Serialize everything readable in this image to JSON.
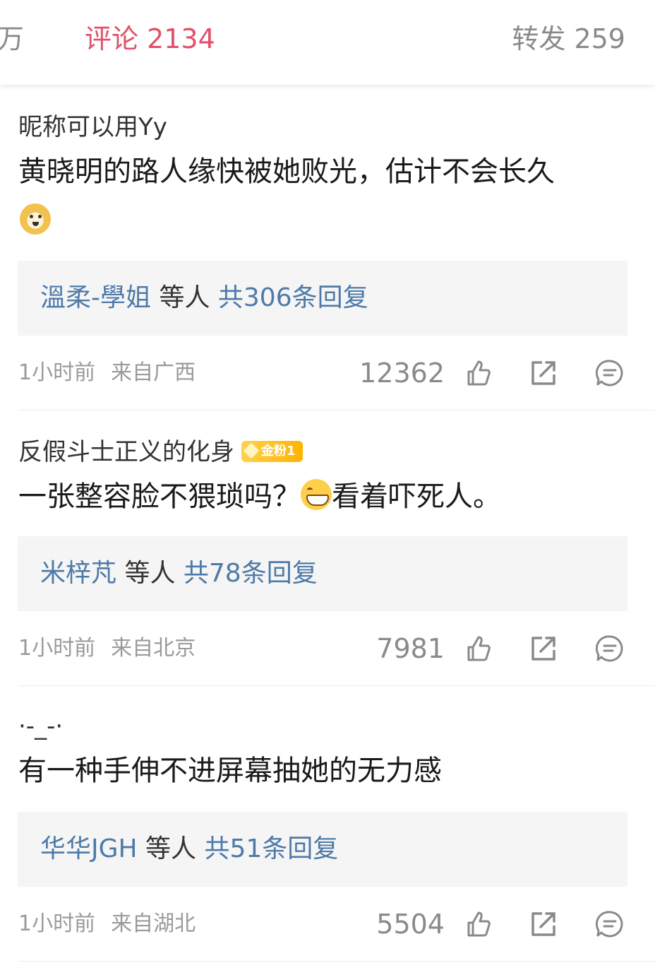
{
  "tabs": {
    "likes_partial": "万",
    "comments": "评论 2134",
    "reposts": "转发 259"
  },
  "comments": [
    {
      "nickname": "昵称可以用Yy",
      "text": "黄晓明的路人缘快被她败光，估计不会长久",
      "emoji": "doge-emoji",
      "reply_user": "溫柔-學姐",
      "reply_mid": " 等人 ",
      "reply_count": "共306条回复",
      "time": "1小时前",
      "location": "来自广西",
      "likes": "12362"
    },
    {
      "nickname": "反假斗士正义的化身",
      "badge": "金粉1",
      "text_before": "一张整容脸不猥琐吗？",
      "emoji": "grin-emoji",
      "text_after": "看着吓死人。",
      "reply_user": "米梓芃",
      "reply_mid": " 等人 ",
      "reply_count": "共78条回复",
      "time": "1小时前",
      "location": "来自北京",
      "likes": "7981"
    },
    {
      "nickname": "·-_-·",
      "text": "有一种手伸不进屏幕抽她的无力感",
      "reply_user": "华华JGH",
      "reply_mid": " 等人 ",
      "reply_count": "共51条回复",
      "time": "1小时前",
      "location": "来自湖北",
      "likes": "5504"
    }
  ],
  "icons": [
    "thumb-up-icon",
    "share-icon",
    "comment-icon"
  ],
  "colors": {
    "accent": "#e2506a",
    "link": "#4e7aa8",
    "muted": "#9a9a9a"
  }
}
